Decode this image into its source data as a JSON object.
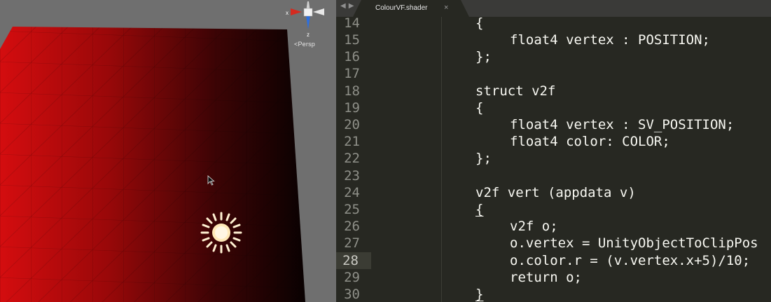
{
  "scene": {
    "persp_label": "Persp",
    "gizmo_axes": {
      "x": "x",
      "z": "z"
    },
    "icons": [
      "orientation-gizmo-icon",
      "pointer-cursor-icon",
      "sun-light-icon"
    ]
  },
  "editor": {
    "tab_nav": {
      "back": "◀",
      "forward": "▶"
    },
    "tab": {
      "title": "ColourVF.shader",
      "close": "×"
    },
    "active_line": 28,
    "lines": [
      {
        "n": "14",
        "indent": 0,
        "text": "{"
      },
      {
        "n": "15",
        "indent": 4,
        "text": "float4 vertex : POSITION;"
      },
      {
        "n": "16",
        "indent": 0,
        "text": "};"
      },
      {
        "n": "17",
        "indent": 0,
        "text": ""
      },
      {
        "n": "18",
        "indent": 0,
        "text": "struct v2f"
      },
      {
        "n": "19",
        "indent": 0,
        "text": "{"
      },
      {
        "n": "20",
        "indent": 4,
        "text": "float4 vertex : SV_POSITION;"
      },
      {
        "n": "21",
        "indent": 4,
        "text": "float4 color: COLOR;"
      },
      {
        "n": "22",
        "indent": 0,
        "text": "};"
      },
      {
        "n": "23",
        "indent": 0,
        "text": ""
      },
      {
        "n": "24",
        "indent": 0,
        "text": "v2f vert (appdata v)"
      },
      {
        "n": "25",
        "indent": 0,
        "text": "{"
      },
      {
        "n": "26",
        "indent": 4,
        "text": "v2f o;"
      },
      {
        "n": "27",
        "indent": 4,
        "text": "o.vertex = UnityObjectToClipPos"
      },
      {
        "n": "28",
        "indent": 4,
        "text": "o.color.r = (v.vertex.x+5)/10;"
      },
      {
        "n": "29",
        "indent": 4,
        "text": "return o;"
      },
      {
        "n": "30",
        "indent": 0,
        "text": "}"
      }
    ]
  }
}
